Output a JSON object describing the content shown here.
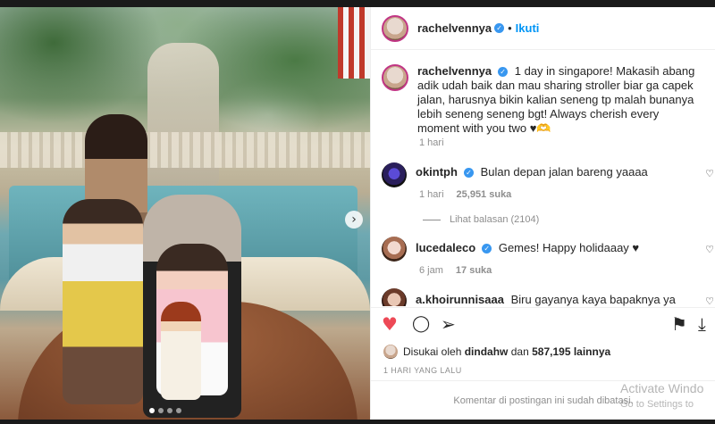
{
  "header": {
    "username": "rachelvennya",
    "follow_label": "Ikuti",
    "separator": "•"
  },
  "caption": {
    "username": "rachelvennya",
    "text": "1 day in singapore! Makasih abang adik udah baik dan mau sharing stroller biar ga capek jalan, harusnya bikin kalian seneng tp malah bunanya lebih seneng seneng bgt! Always cherish every moment with you two ♥︎🫶",
    "time": "1 hari"
  },
  "comments": [
    {
      "username": "okintph",
      "verified": true,
      "text": "Bulan depan jalan bareng yaaaa",
      "time": "1 hari",
      "likes": "25,951 suka",
      "replies": "Lihat balasan (2104)"
    },
    {
      "username": "lucedaleco",
      "verified": true,
      "text": "Gemes! Happy holidaaay ♥",
      "time": "6 jam",
      "likes": "17 suka"
    },
    {
      "username": "a.khoirunnisaaa",
      "verified": false,
      "text": "Biru gayanya kaya bapaknya ya"
    }
  ],
  "likes": {
    "prefix": "Disukai oleh",
    "user": "dindahw",
    "conj": "dan",
    "count": "587,195 lainnya"
  },
  "date": "1 HARI YANG LALU",
  "footer": {
    "text": "Komentar di postingan ini sudah dibatasi."
  },
  "watermark": {
    "line1": "Activate Windo",
    "line2": "Go to Settings to"
  },
  "icons": {
    "verified": "✓",
    "heart_small": "♡",
    "next": "›",
    "like": "♥",
    "comment": "◯",
    "share": "➢",
    "save": "⚑",
    "download": "⤓"
  },
  "colors": {
    "like_red": "#ed4956",
    "verified_blue": "#3897f0",
    "follow_blue": "#0095f6"
  },
  "carousel": {
    "slides": 4,
    "active": 1
  }
}
